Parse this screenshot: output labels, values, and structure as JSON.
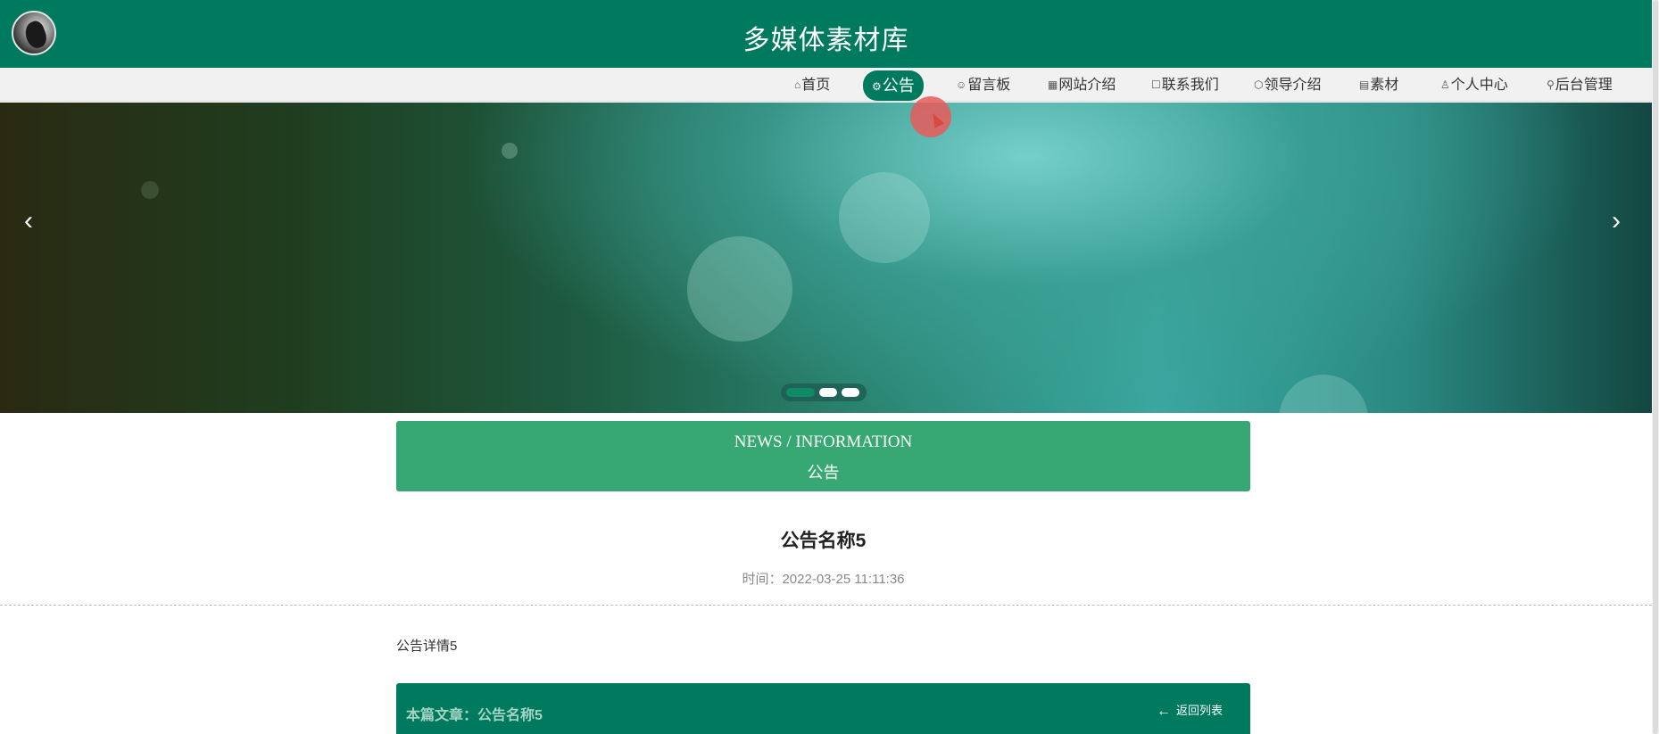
{
  "header": {
    "title": "多媒体素材库"
  },
  "nav": {
    "items": [
      {
        "icon": "home-icon",
        "glyph": "⌂",
        "label": "首页"
      },
      {
        "icon": "gear-icon",
        "glyph": "⚙",
        "label": "公告",
        "active": true
      },
      {
        "icon": "message-icon",
        "glyph": "☺",
        "label": "留言板"
      },
      {
        "icon": "grid-icon",
        "glyph": "▦",
        "label": "网站介绍"
      },
      {
        "icon": "contact-icon",
        "glyph": "☐",
        "label": "联系我们"
      },
      {
        "icon": "cube-icon",
        "glyph": "⬡",
        "label": "领导介绍"
      },
      {
        "icon": "calendar-icon",
        "glyph": "▤",
        "label": "素材"
      },
      {
        "icon": "user-icon",
        "glyph": "♙",
        "label": "个人中心"
      },
      {
        "icon": "link-icon",
        "glyph": "⚲",
        "label": "后台管理"
      }
    ]
  },
  "banner": {
    "prev_glyph": "‹",
    "next_glyph": "›",
    "slide_count": 3,
    "active_slide": 1
  },
  "section": {
    "en_title": "NEWS / INFORMATION",
    "cn_title": "公告"
  },
  "article": {
    "title": "公告名称5",
    "time": "时间：2022-03-25 11:11:36",
    "body": "公告详情5"
  },
  "footer": {
    "this_article": "本篇文章：公告名称5",
    "back_glyph": "←",
    "back_label": "返回列表"
  },
  "overlay": {
    "text": ""
  },
  "colors": {
    "primary": "#007a5e",
    "section": "#37a873",
    "nav_bg": "#f1f1f1"
  }
}
